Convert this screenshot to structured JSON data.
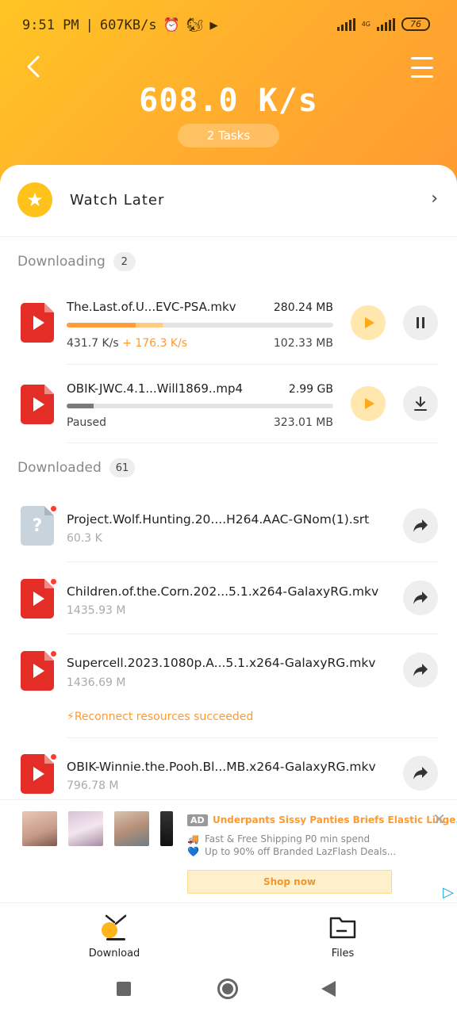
{
  "status_bar": {
    "time": "9:51 PM",
    "net_speed": "607KB/s",
    "network": "4G",
    "battery": "76"
  },
  "header": {
    "speed": "608.0 K/s",
    "tasks": "2 Tasks"
  },
  "watch_later": {
    "label": "Watch Later"
  },
  "downloading": {
    "title": "Downloading",
    "count": "2",
    "items": [
      {
        "name": "The.Last.of.U...EVC-PSA.mkv",
        "size": "280.24 MB",
        "speed": "431.7 K/s",
        "boost": "+ 176.3 K/s",
        "downloaded": "102.33 MB",
        "progress": 0.36,
        "status": "downloading"
      },
      {
        "name": "OBIK-JWC.4.1...Will1869..mp4",
        "size": "2.99 GB",
        "speed": "Paused",
        "boost": "",
        "downloaded": "323.01 MB",
        "progress": 0.1,
        "status": "paused"
      }
    ]
  },
  "downloaded": {
    "title": "Downloaded",
    "count": "61",
    "items": [
      {
        "name": "Project.Wolf.Hunting.20....H264.AAC-GNom(1).srt",
        "size": "60.3 K",
        "icon": "unknown-file-icon"
      },
      {
        "name": "Children.of.the.Corn.202...5.1.x264-GalaxyRG.mkv",
        "size": "1435.93 M",
        "icon": "video-file-icon"
      },
      {
        "name": "Supercell.2023.1080p.A...5.1.x264-GalaxyRG.mkv",
        "size": "1436.69 M",
        "icon": "video-file-icon",
        "note": "⚡Reconnect resources succeeded"
      },
      {
        "name": "OBIK-Winnie.the.Pooh.Bl...MB.x264-GalaxyRG.mkv",
        "size": "796.78 M",
        "icon": "video-file-icon"
      }
    ]
  },
  "ad": {
    "badge": "AD",
    "title": "Underpants Sissy Panties Briefs Elastic Linge...",
    "line1": "Fast & Free Shipping P0 min spend",
    "line2": "Up to 90% off Branded LazFlash Deals...",
    "button": "Shop now"
  },
  "bottom_nav": {
    "download": "Download",
    "files": "Files"
  },
  "colors": {
    "accent": "#ffa81a",
    "header_start": "#ffc524",
    "header_end": "#ff9a30",
    "file_red": "#e52d27"
  }
}
